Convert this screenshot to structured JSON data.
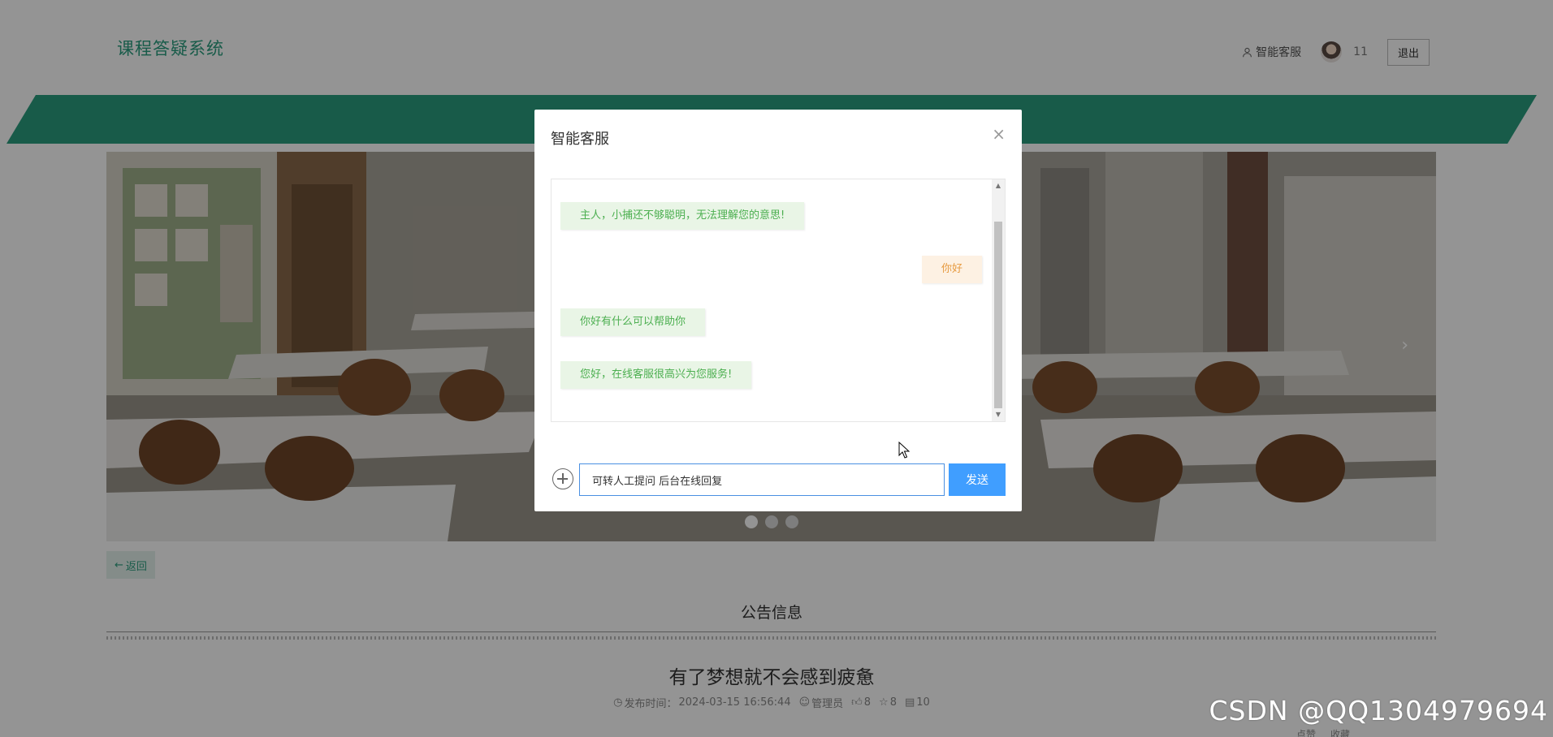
{
  "header": {
    "site_title": "课程答疑系统",
    "service_label": "智能客服",
    "username": "11",
    "logout_label": "退出"
  },
  "colors": {
    "brand_green": "#2a9d7f",
    "send_blue": "#409eff",
    "bot_bubble_bg": "#e9f5e6",
    "user_bubble_bg": "#fdf1e3"
  },
  "carousel": {
    "next_arrow": "›",
    "dot_count": 3,
    "active_dot": 1
  },
  "page": {
    "back_label": "返回",
    "section_title": "公告信息",
    "article_title": "有了梦想就不会感到疲惫",
    "meta": {
      "publish_label": "发布时间：",
      "publish_time": "2024-03-15 16:56:44",
      "author": "管理员",
      "likes": "8",
      "favorites": "8",
      "views": "10"
    },
    "bottom_actions": [
      "点赞",
      "收藏"
    ]
  },
  "dialog": {
    "title": "智能客服",
    "close_icon": "×",
    "messages": [
      {
        "role": "bot",
        "text": "主人，小捕还不够聪明，无法理解您的意思!"
      },
      {
        "role": "user",
        "text": "你好"
      },
      {
        "role": "bot",
        "text": "你好有什么可以帮助你"
      },
      {
        "role": "bot",
        "text": "您好，在线客服很高兴为您服务!"
      }
    ],
    "input_value": "可转人工提问 后台在线回复",
    "send_label": "发送"
  },
  "watermark": "CSDN @QQ1304979694"
}
